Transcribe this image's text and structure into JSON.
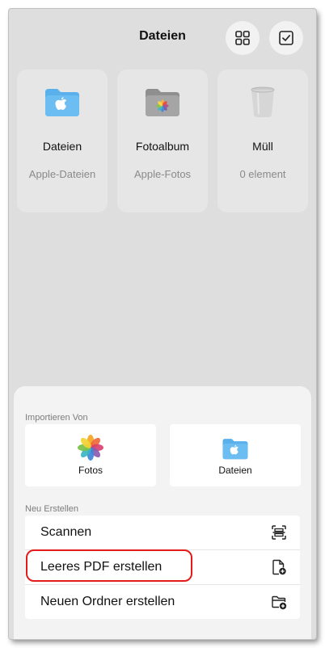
{
  "header": {
    "title": "Dateien",
    "grid_icon": "grid-view-icon",
    "select_icon": "checkbox-select-icon"
  },
  "locations": [
    {
      "name": "Dateien",
      "subtitle": "Apple-Dateien",
      "icon": "blue-folder-icon"
    },
    {
      "name": "Fotoalbum",
      "subtitle": "Apple-Fotos",
      "icon": "photos-folder-icon"
    },
    {
      "name": "Müll",
      "subtitle": "0 element",
      "icon": "trash-icon"
    }
  ],
  "sheet": {
    "import_label": "Importieren Von",
    "import_options": [
      {
        "label": "Fotos",
        "icon": "photos-app-icon"
      },
      {
        "label": "Dateien",
        "icon": "files-folder-icon"
      }
    ],
    "create_label": "Neu Erstellen",
    "create_options": [
      {
        "label": "Scannen",
        "icon": "scan-icon"
      },
      {
        "label": "Leeres PDF erstellen",
        "icon": "new-document-icon"
      },
      {
        "label": "Neuen Ordner erstellen",
        "icon": "new-folder-icon"
      }
    ]
  },
  "colors": {
    "highlight": "#e41b1b",
    "folder_blue": "#5ab0ea",
    "background": "#dedede"
  }
}
